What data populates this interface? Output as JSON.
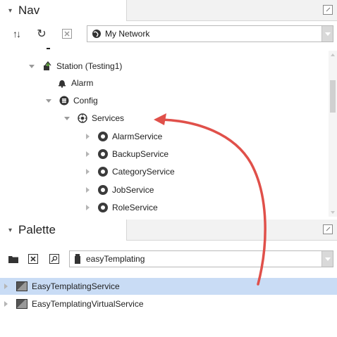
{
  "nav": {
    "tab_label": "Nav",
    "network_select": "My Network",
    "tree": {
      "station": "Station (Testing1)",
      "alarm": "Alarm",
      "config": "Config",
      "services": "Services",
      "children": [
        "AlarmService",
        "BackupService",
        "CategoryService",
        "JobService",
        "RoleService"
      ]
    }
  },
  "palette": {
    "tab_label": "Palette",
    "module_select": "easyTemplating",
    "items": [
      "EasyTemplatingService",
      "EasyTemplatingVirtualService"
    ],
    "selected_index": 0
  },
  "colors": {
    "selection": "#c9dcf5",
    "annotation_arrow": "#e0504a"
  },
  "icons": [
    "collapse-arrow-icon",
    "sort-icon",
    "refresh-icon",
    "close-box-icon",
    "globe-icon",
    "folder-icon",
    "find-icon",
    "module-jar-icon",
    "station-icon",
    "bell-icon",
    "database-icon",
    "services-icon",
    "service-icon",
    "cube-icon",
    "maximize-icon"
  ]
}
